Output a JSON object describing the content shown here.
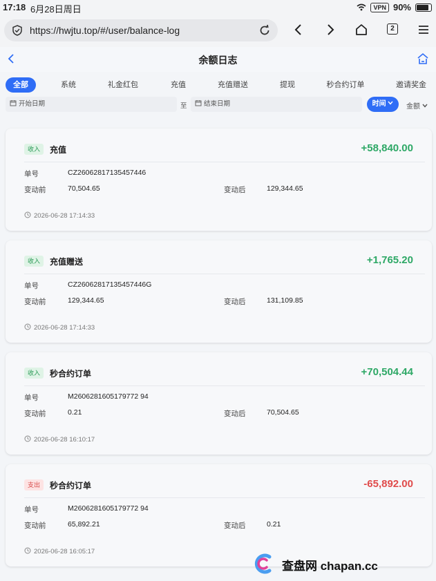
{
  "status_bar": {
    "time": "17:18",
    "date": "6月28日周日",
    "vpn": "VPN",
    "battery": "90%"
  },
  "browser": {
    "url": "https://hwjtu.top/#/user/balance-log",
    "tab_count": "2"
  },
  "header": {
    "title": "余额日志"
  },
  "tabs": [
    {
      "label": "全部",
      "active": true
    },
    {
      "label": "系统"
    },
    {
      "label": "礼金红包"
    },
    {
      "label": "充值"
    },
    {
      "label": "充值赠送"
    },
    {
      "label": "提现"
    },
    {
      "label": "秒合约订单"
    },
    {
      "label": "邀请奖金"
    }
  ],
  "filters": {
    "start_date": "开始日期",
    "to": "至",
    "end_date": "结束日期",
    "sort_time": "时间",
    "sort_amount": "金额"
  },
  "labels": {
    "order_no": "单号",
    "before": "变动前",
    "after": "变动后"
  },
  "records": [
    {
      "badge": "收入",
      "type": "in",
      "title": "充值",
      "amount": "+58,840.00",
      "order_no": "CZ26062817135457446",
      "before": "70,504.65",
      "after": "129,344.65",
      "time": "2026-06-28 17:14:33"
    },
    {
      "badge": "收入",
      "type": "in",
      "title": "充值赠送",
      "amount": "+1,765.20",
      "order_no": "CZ26062817135457446G",
      "before": "129,344.65",
      "after": "131,109.85",
      "time": "2026-06-28 17:14:33"
    },
    {
      "badge": "收入",
      "type": "in",
      "title": "秒合约订单",
      "amount": "+70,504.44",
      "order_no": "M2606281605179772 94",
      "before": "0.21",
      "after": "70,504.65",
      "time": "2026-06-28 16:10:17"
    },
    {
      "badge": "支出",
      "type": "out",
      "title": "秒合约订单",
      "amount": "-65,892.00",
      "order_no": "M2606281605179772 94",
      "before": "65,892.21",
      "after": "0.21",
      "time": "2026-06-28 16:05:17"
    }
  ],
  "watermark": {
    "text": "查盘网 chapan.cc"
  },
  "colors": {
    "accent": "#2f6df6",
    "income": "#2ea866",
    "expense": "#e04b4b"
  }
}
